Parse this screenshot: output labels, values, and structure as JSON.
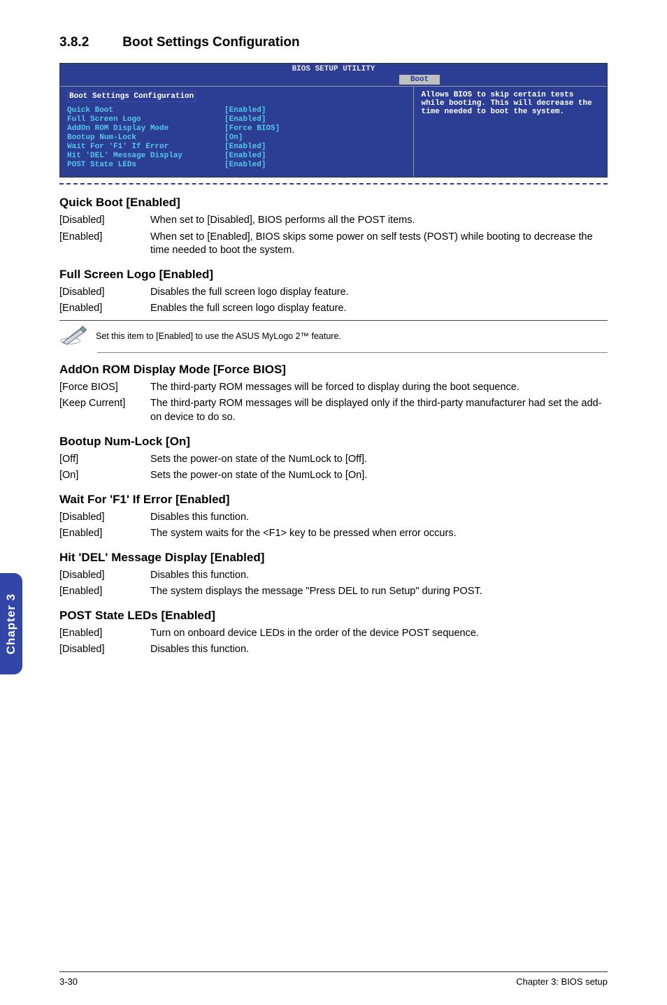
{
  "heading": {
    "num": "3.8.2",
    "title": "Boot Settings Configuration"
  },
  "bios": {
    "title": "BIOS SETUP UTILITY",
    "active_tab": "Boot",
    "section_label": "Boot Settings Configuration",
    "items": [
      {
        "k": "Quick Boot",
        "v": "[Enabled]"
      },
      {
        "k": "Full Screen Logo",
        "v": "[Enabled]"
      },
      {
        "k": "AddOn ROM Display Mode",
        "v": "[Force BIOS]"
      },
      {
        "k": "Bootup Num-Lock",
        "v": "[On]"
      },
      {
        "k": "Wait For 'F1' If Error",
        "v": "[Enabled]"
      },
      {
        "k": "Hit 'DEL' Message Display",
        "v": "[Enabled]"
      },
      {
        "k": "POST State LEDs",
        "v": "[Enabled]"
      }
    ],
    "help": "Allows BIOS to skip certain tests while booting. This will decrease the time needed to boot the system."
  },
  "settings": [
    {
      "title": "Quick Boot [Enabled]",
      "rows": [
        {
          "key": "[Disabled]",
          "val": "When set to [Disabled], BIOS performs all the POST items."
        },
        {
          "key": "[Enabled]",
          "val": "When set to [Enabled], BIOS skips some power on self tests (POST) while booting to decrease the time needed to boot the system."
        }
      ],
      "note": null
    },
    {
      "title": "Full Screen Logo [Enabled]",
      "rows": [
        {
          "key": "[Disabled]",
          "val": "Disables the full screen logo display feature."
        },
        {
          "key": "[Enabled]",
          "val": "Enables the full screen logo display feature."
        }
      ],
      "note": "Set this item to [Enabled] to use the ASUS MyLogo 2™ feature."
    },
    {
      "title": "AddOn ROM Display Mode [Force BIOS]",
      "rows": [
        {
          "key": "[Force BIOS]",
          "val": "The third-party ROM messages will be forced to display during the boot sequence."
        },
        {
          "key": "[Keep Current]",
          "val": "The third-party ROM messages will be displayed only if the third-party manufacturer had set the add-on device to do so."
        }
      ],
      "note": null
    },
    {
      "title": "Bootup Num-Lock [On]",
      "rows": [
        {
          "key": "[Off]",
          "val": "Sets the power-on state of the NumLock to [Off]."
        },
        {
          "key": "[On]",
          "val": "Sets the power-on state of the NumLock to [On]."
        }
      ],
      "note": null
    },
    {
      "title": "Wait For 'F1' If Error [Enabled]",
      "rows": [
        {
          "key": "[Disabled]",
          "val": "Disables this function."
        },
        {
          "key": "[Enabled]",
          "val": "The system waits for the <F1> key to be pressed when error occurs."
        }
      ],
      "note": null
    },
    {
      "title": "Hit 'DEL' Message Display [Enabled]",
      "rows": [
        {
          "key": "[Disabled]",
          "val": "Disables this function."
        },
        {
          "key": "[Enabled]",
          "val": "The system displays the message \"Press DEL to run Setup\" during POST."
        }
      ],
      "note": null
    },
    {
      "title": "POST State LEDs [Enabled]",
      "rows": [
        {
          "key": "[Enabled]",
          "val": "Turn on onboard device LEDs in the order of the device POST sequence."
        },
        {
          "key": "[Disabled]",
          "val": "Disables this function."
        }
      ],
      "note": null
    }
  ],
  "side_tab": "Chapter 3",
  "footer": {
    "left": "3-30",
    "right": "Chapter 3: BIOS setup"
  }
}
